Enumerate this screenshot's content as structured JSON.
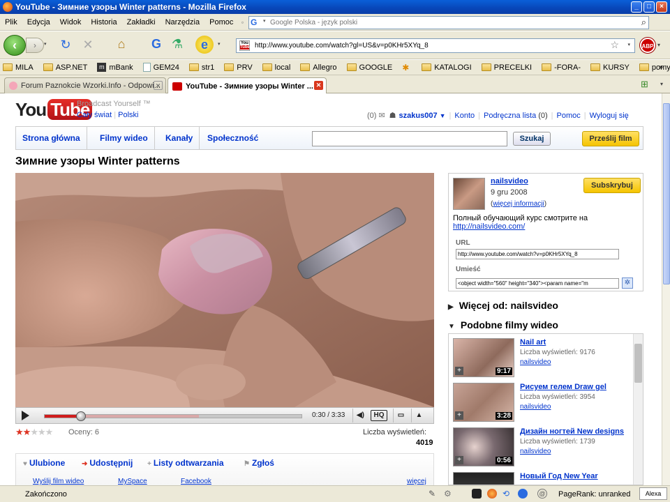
{
  "window": {
    "title": "YouTube - Зимние узоры Winter patterns - Mozilla Firefox",
    "minimize": "_",
    "maximize": "□",
    "close": "×"
  },
  "menu": {
    "items": [
      "Plik",
      "Edycja",
      "Widok",
      "Historia",
      "Zakładki",
      "Narzędzia",
      "Pomoc"
    ],
    "search_placeholder": "Google Polska - język polski"
  },
  "navigation": {
    "url": "http://www.youtube.com/watch?gl=US&v=p0KHr5XYq_8",
    "abp_label": "ABP"
  },
  "bookmarks": [
    {
      "label": "MILA",
      "icon": "folder-icon"
    },
    {
      "label": "ASP.NET",
      "icon": "folder-icon"
    },
    {
      "label": "mBank",
      "icon": "mbank-icon"
    },
    {
      "label": "GEM24",
      "icon": "page-icon"
    },
    {
      "label": "str1",
      "icon": "folder-icon"
    },
    {
      "label": "PRV",
      "icon": "folder-icon"
    },
    {
      "label": "local",
      "icon": "folder-icon"
    },
    {
      "label": "Allegro",
      "icon": "folder-icon"
    },
    {
      "label": "GOOGLE",
      "icon": "folder-icon"
    },
    {
      "label": "",
      "icon": "feed-icon"
    },
    {
      "label": "KATALOGI",
      "icon": "folder-icon"
    },
    {
      "label": "PRECELKI",
      "icon": "folder-icon"
    },
    {
      "label": "-FORA-",
      "icon": "folder-icon"
    },
    {
      "label": "KURSY",
      "icon": "folder-icon"
    },
    {
      "label": "pomysły",
      "icon": "folder-icon"
    }
  ],
  "tabs": [
    {
      "label": "Forum Paznokcie Wzorki.Info - Odpowi...",
      "active": false
    },
    {
      "label": "YouTube - Зимние узоры Winter ...",
      "active": true
    }
  ],
  "youtube": {
    "logo_you": "You",
    "logo_tube": "Tube",
    "tagline": "Broadcast Yourself ™",
    "region_world": "Cały świat",
    "region_country": "Polski",
    "inbox_count": "(0)",
    "username": "szakus007",
    "account": "Konto",
    "quicklist": "Podręczna lista",
    "quicklist_count": "(0)",
    "help": "Pomoc",
    "logout": "Wyloguj się",
    "nav": [
      "Strona główna",
      "Filmy wideo",
      "Kanały",
      "Społeczność"
    ],
    "search_button": "Szukaj",
    "upload_button": "Prześlij film"
  },
  "video": {
    "title": "Зимние узоры Winter patterns",
    "time_current": "0:30",
    "time_total": "3:33",
    "time_display": "0:30 / 3:33",
    "progress_played": 0.14,
    "progress_loaded": 0.6,
    "hq_label": "HQ",
    "rating": 2,
    "rating_max": 5,
    "ratings_label": "Oceny: 6",
    "views_label": "Liczba wyświetleń:",
    "views_count": "4019"
  },
  "actions": {
    "favorites": "Ulubione",
    "share": "Udostępnij",
    "playlists": "Listy odtwarzania",
    "flag": "Zgłoś",
    "send_video": "Wyślij film wideo",
    "myspace": "MySpace",
    "facebook": "Facebook",
    "more": "więcej"
  },
  "info": {
    "uploader": "nailsvideo",
    "date": "9 gru 2008",
    "more_info": "więcej informacji",
    "description": "Полный обучающий курс смотрите на",
    "description_link": "http://nailsvideo.com/",
    "subscribe": "Subskrybuj",
    "url_label": "URL",
    "url_value": "http://www.youtube.com/watch?v=p0KHr5XYq_8",
    "embed_label": "Umieść",
    "embed_value": "<object width=\"560\" height=\"340\"><param name=\"m"
  },
  "sections": {
    "more_from": "Więcej od: nailsvideo",
    "related": "Podobne filmy wideo"
  },
  "related": [
    {
      "title": "Nail art",
      "views": "Liczba wyświetleń: 9176",
      "user": "nailsvideo",
      "duration": "9:17"
    },
    {
      "title": "Рисуем гелем Draw gel",
      "views": "Liczba wyświetleń: 3954",
      "user": "nailsvideo",
      "duration": "3:28"
    },
    {
      "title": "Дизайн ногтей New designs",
      "views": "Liczba wyświetleń: 1739",
      "user": "nailsvideo",
      "duration": "0:56"
    },
    {
      "title": "Новый Год New Year",
      "views": "",
      "user": "",
      "duration": ""
    }
  ],
  "statusbar": {
    "status": "Zakończono",
    "pagerank": "PageRank: unranked",
    "alexa": "Alexa"
  },
  "colors": {
    "link": "#0033cc",
    "youtube_red": "#cc0000",
    "xp_blue": "#0a5fd8",
    "subscribe_yellow": "#f5c400"
  }
}
